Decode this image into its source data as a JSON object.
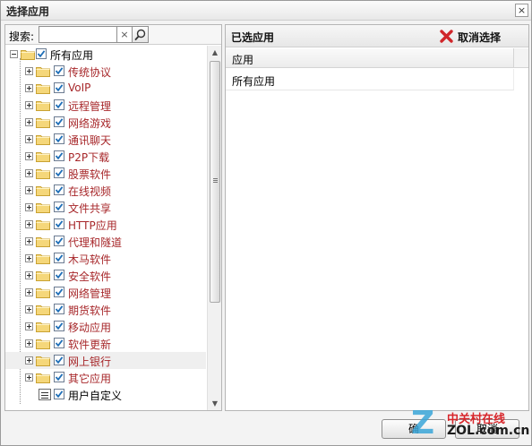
{
  "dialog": {
    "title": "选择应用",
    "close_glyph": "×"
  },
  "search": {
    "label": "搜索:",
    "value": "",
    "placeholder": "",
    "clear_glyph": "×"
  },
  "tree": {
    "root": {
      "label": "所有应用",
      "checked": true,
      "expanded": true
    },
    "items": [
      {
        "label": "传统协议",
        "checked": true,
        "color": "red",
        "icon": "folder-icon"
      },
      {
        "label": "VoIP",
        "checked": true,
        "color": "red",
        "icon": "folder-icon"
      },
      {
        "label": "远程管理",
        "checked": true,
        "color": "red",
        "icon": "folder-icon"
      },
      {
        "label": "网络游戏",
        "checked": true,
        "color": "red",
        "icon": "folder-icon"
      },
      {
        "label": "通讯聊天",
        "checked": true,
        "color": "red",
        "icon": "folder-icon"
      },
      {
        "label": "P2P下载",
        "checked": true,
        "color": "red",
        "icon": "folder-icon"
      },
      {
        "label": "股票软件",
        "checked": true,
        "color": "red",
        "icon": "folder-icon"
      },
      {
        "label": "在线视频",
        "checked": true,
        "color": "red",
        "icon": "folder-icon"
      },
      {
        "label": "文件共享",
        "checked": true,
        "color": "red",
        "icon": "folder-icon"
      },
      {
        "label": "HTTP应用",
        "checked": true,
        "color": "red",
        "icon": "folder-icon"
      },
      {
        "label": "代理和隧道",
        "checked": true,
        "color": "red",
        "icon": "folder-icon"
      },
      {
        "label": "木马软件",
        "checked": true,
        "color": "red",
        "icon": "folder-icon"
      },
      {
        "label": "安全软件",
        "checked": true,
        "color": "red",
        "icon": "folder-icon"
      },
      {
        "label": "网络管理",
        "checked": true,
        "color": "red",
        "icon": "folder-icon"
      },
      {
        "label": "期货软件",
        "checked": true,
        "color": "red",
        "icon": "folder-icon"
      },
      {
        "label": "移动应用",
        "checked": true,
        "color": "red",
        "icon": "folder-icon"
      },
      {
        "label": "软件更新",
        "checked": true,
        "color": "red",
        "icon": "folder-icon"
      },
      {
        "label": "网上银行",
        "checked": true,
        "color": "red",
        "icon": "folder-icon",
        "highlighted": true
      },
      {
        "label": "其它应用",
        "checked": true,
        "color": "red",
        "icon": "folder-icon"
      },
      {
        "label": "用户自定义",
        "checked": true,
        "color": "black",
        "icon": "list-icon"
      }
    ]
  },
  "selected_panel": {
    "title": "已选应用",
    "cancel_label": "取消选择",
    "column_header": "应用",
    "rows": [
      "所有应用"
    ]
  },
  "footer": {
    "ok_label": "确",
    "cancel_label": "取消"
  },
  "watermark": {
    "logo_letter": "Z",
    "cn_text": "中关村在线",
    "en_text": "ZOL.com.cn"
  },
  "colors": {
    "category_text": "#a7272a",
    "folder_fill": "#f5d77a",
    "folder_stroke": "#c9a233",
    "check_mark": "#1f6fb8",
    "cancel_icon": "#d0262a",
    "watermark_blue": "#3aa6d9",
    "watermark_red": "#d8262b"
  }
}
